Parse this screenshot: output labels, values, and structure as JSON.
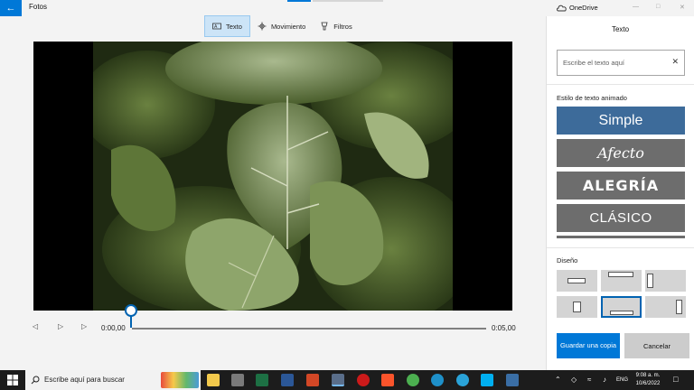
{
  "app": {
    "title": "Fotos"
  },
  "toolbar": {
    "tabs": [
      {
        "label": "Texto",
        "icon": "text-icon",
        "active": true
      },
      {
        "label": "Movimiento",
        "icon": "move-icon",
        "active": false
      },
      {
        "label": "Filtros",
        "icon": "filter-icon",
        "active": false
      }
    ]
  },
  "playback": {
    "current_time": "0:00,00",
    "end_time": "0:05,00",
    "progress": 0.0
  },
  "onedrive": {
    "label": "OneDrive"
  },
  "panel": {
    "title": "Texto",
    "text_input": {
      "placeholder": "Escribe el texto aquí",
      "value": ""
    },
    "animated_style_label": "Estilo de texto animado",
    "styles": [
      {
        "label": "Simple",
        "selected": true
      },
      {
        "label": "Afecto",
        "selected": false
      },
      {
        "label": "ALEGRÍA",
        "selected": false
      },
      {
        "label": "CLÁSICO",
        "selected": false
      }
    ],
    "layout_label": "Diseño",
    "layout_selected_index": 4,
    "save_button": "Guardar una copia",
    "cancel_button": "Cancelar"
  },
  "taskbar": {
    "search_placeholder": "Escribe aquí para buscar",
    "language": "ENG",
    "time": "9:08 a. m.",
    "date": "10/6/2022"
  },
  "colors": {
    "accent": "#0078d7",
    "style_selected": "#3d6b9a",
    "style_default": "#6d6d6d"
  }
}
